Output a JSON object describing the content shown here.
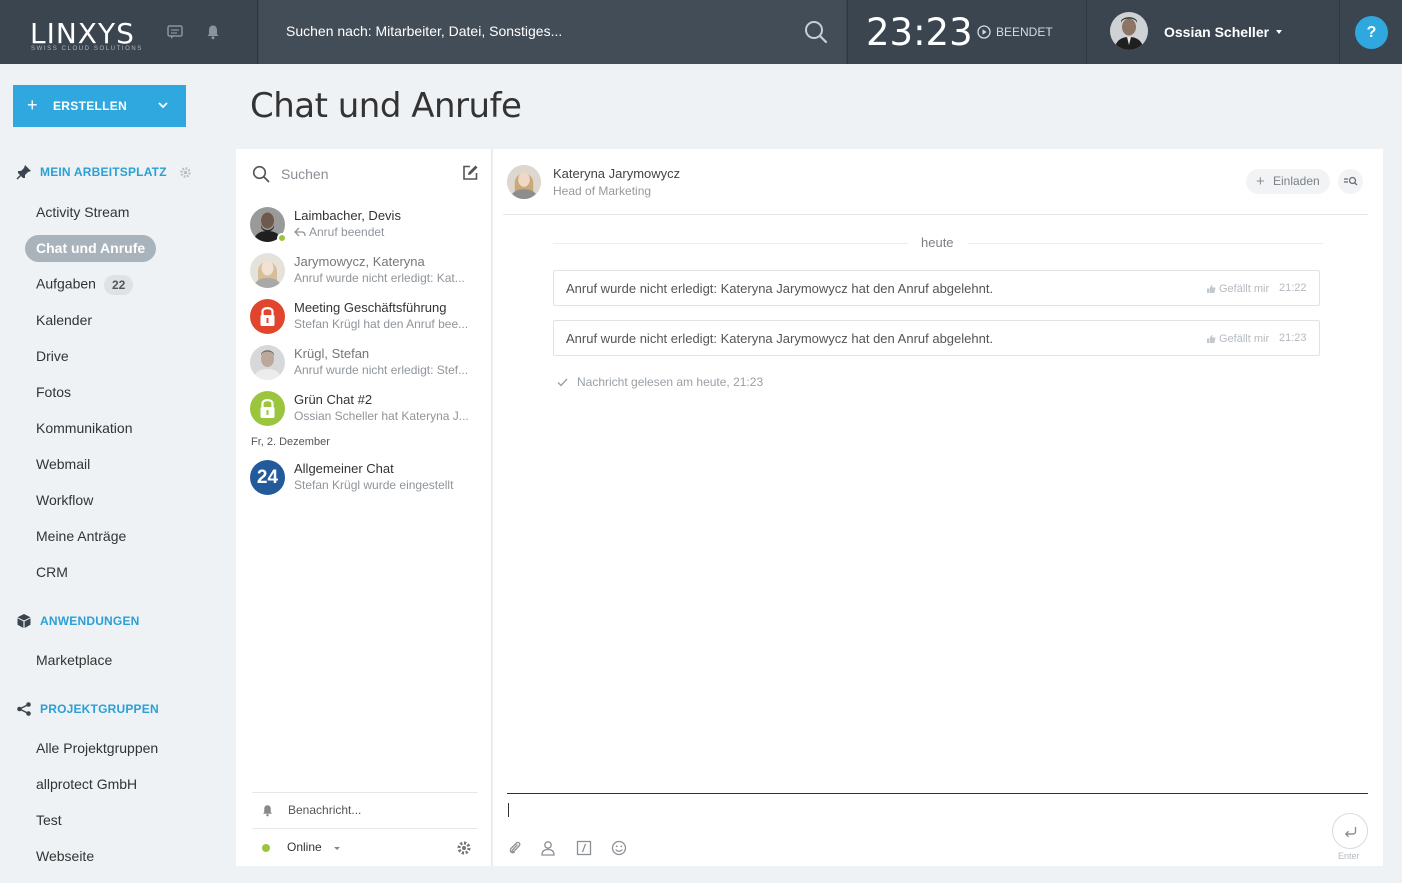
{
  "topbar": {
    "logo": "LINXYS",
    "logo_sub": "SWISS CLOUD SOLUTIONS",
    "search_placeholder": "Suchen nach: Mitarbeiter, Datei, Sonstiges...",
    "clock": "23:23",
    "clock_status": "BEENDET",
    "user_name": "Ossian Scheller",
    "help": "?"
  },
  "sidebar": {
    "create_label": "ERSTELLEN",
    "section_workspace": "MEIN ARBEITSPLATZ",
    "workspace_items": [
      {
        "label": "Activity Stream"
      },
      {
        "label": "Chat und Anrufe",
        "active": true
      },
      {
        "label": "Aufgaben",
        "badge": "22"
      },
      {
        "label": "Kalender"
      },
      {
        "label": "Drive"
      },
      {
        "label": "Fotos"
      },
      {
        "label": "Kommunikation"
      },
      {
        "label": "Webmail"
      },
      {
        "label": "Workflow"
      },
      {
        "label": "Meine Anträge"
      },
      {
        "label": "CRM"
      }
    ],
    "section_apps": "ANWENDUNGEN",
    "apps_items": [
      {
        "label": "Marketplace"
      }
    ],
    "section_groups": "PROJEKTGRUPPEN",
    "group_items": [
      {
        "label": "Alle Projektgruppen"
      },
      {
        "label": "allprotect GmbH"
      },
      {
        "label": "Test"
      },
      {
        "label": "Webseite"
      }
    ]
  },
  "page_title": "Chat und Anrufe",
  "chat_list": {
    "search_placeholder": "Suchen",
    "items": [
      {
        "name": "Laimbacher, Devis",
        "sub": "Anruf beendet",
        "online": true
      },
      {
        "name": "Jarymowycz, Kateryna",
        "sub": "Anruf wurde nicht erledigt: Kat...",
        "muted": true
      },
      {
        "name": "Meeting Geschäftsführung",
        "sub": "Stefan Krügl hat den Anruf bee...",
        "color": "#e2452d"
      },
      {
        "name": "Krügl, Stefan",
        "sub": "Anruf wurde nicht erledigt: Stef...",
        "muted": true
      },
      {
        "name": "Grün Chat #2",
        "sub": "Ossian Scheller hat Kateryna J...",
        "color": "#9bc53d"
      }
    ],
    "date_separator": "Fr, 2. Dezember",
    "older_items": [
      {
        "name": "Allgemeiner Chat",
        "sub": "Stefan Krügl wurde eingestellt",
        "avatar_text": "24",
        "color": "#225a9c"
      }
    ],
    "notifications_label": "Benachricht...",
    "status_label": "Online"
  },
  "conversation": {
    "name": "Kateryna Jarymowycz",
    "role": "Head of Marketing",
    "invite_label": "Einladen",
    "day_label": "heute",
    "messages": [
      {
        "text": "Anruf wurde nicht erledigt: Kateryna Jarymowycz hat den Anruf abgelehnt.",
        "like": "Gefällt mir",
        "time": "21:22"
      },
      {
        "text": "Anruf wurde nicht erledigt: Kateryna Jarymowycz hat den Anruf abgelehnt.",
        "like": "Gefällt mir",
        "time": "21:23"
      }
    ],
    "read_note": "Nachricht gelesen am heute, 21:23",
    "send_label": "Enter"
  },
  "colors": {
    "topbar": "#3b4550",
    "accent": "#2fa8df",
    "online": "#9bc53d",
    "meeting": "#e2452d",
    "general_chat": "#225a9c"
  }
}
